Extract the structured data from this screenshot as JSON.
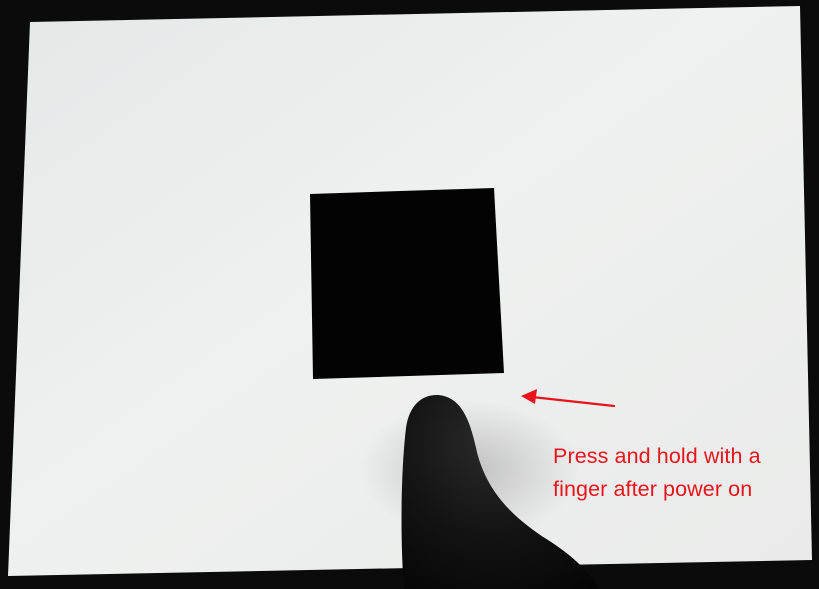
{
  "annotation": {
    "line1": "Press and hold with a",
    "line2": "finger after power on",
    "color": "#e8141c"
  },
  "screen": {
    "background": "#eceeed",
    "target_color": "#030303"
  },
  "icons": {
    "arrow": "left-arrow-icon",
    "finger": "finger"
  }
}
